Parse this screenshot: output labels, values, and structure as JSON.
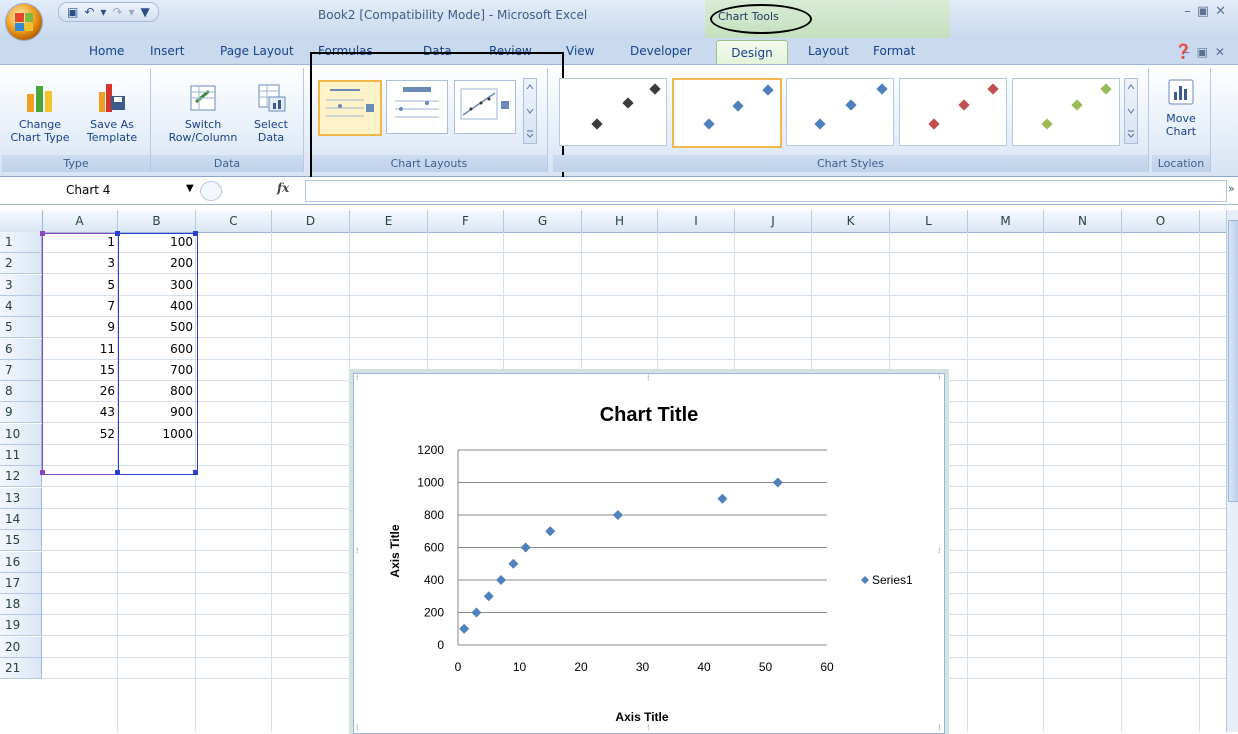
{
  "window": {
    "title": "Book2  [Compatibility Mode] - Microsoft Excel",
    "contextual_tab_group": "Chart Tools"
  },
  "tabs": [
    "Home",
    "Insert",
    "Page Layout",
    "Formulas",
    "Data",
    "Review",
    "View",
    "Developer",
    "Design",
    "Layout",
    "Format"
  ],
  "ribbon": {
    "type_group": {
      "label": "Type",
      "change_chart_type": "Change Chart Type",
      "save_as_template": "Save As Template"
    },
    "data_group": {
      "label": "Data",
      "switch_row_column": "Switch Row/Column",
      "select_data": "Select Data"
    },
    "chart_layouts_label": "Chart Layouts",
    "chart_styles_label": "Chart Styles",
    "location_group": {
      "label": "Location",
      "move_chart": "Move Chart"
    }
  },
  "formula_bar": {
    "name_box": "Chart 4",
    "fx_label": "fx",
    "formula": ""
  },
  "sheet": {
    "columns": [
      "A",
      "B",
      "C",
      "D",
      "E",
      "F",
      "G",
      "H",
      "I",
      "J",
      "K",
      "L",
      "M",
      "N",
      "O"
    ],
    "rows": [
      "1",
      "2",
      "3",
      "4",
      "5",
      "6",
      "7",
      "8",
      "9",
      "10",
      "11",
      "12",
      "13",
      "14",
      "15",
      "16",
      "17",
      "18",
      "19",
      "20",
      "21"
    ],
    "col_a": [
      "1",
      "3",
      "5",
      "7",
      "9",
      "11",
      "15",
      "26",
      "43",
      "52"
    ],
    "col_b": [
      "100",
      "200",
      "300",
      "400",
      "500",
      "600",
      "700",
      "800",
      "900",
      "1000"
    ]
  },
  "chart_data": {
    "type": "scatter",
    "title": "Chart Title",
    "xlabel": "Axis Title",
    "ylabel": "Axis Title",
    "xlim": [
      0,
      60
    ],
    "ylim": [
      0,
      1200
    ],
    "x_ticks": [
      "0",
      "10",
      "20",
      "30",
      "40",
      "50",
      "60"
    ],
    "y_ticks": [
      "0",
      "200",
      "400",
      "600",
      "800",
      "1000",
      "1200"
    ],
    "grid": "horizontal major gridlines",
    "legend_position": "right",
    "series": [
      {
        "name": "Series1",
        "x": [
          1,
          3,
          5,
          7,
          9,
          11,
          15,
          26,
          43,
          52
        ],
        "y": [
          100,
          200,
          300,
          400,
          500,
          600,
          700,
          800,
          900,
          1000
        ],
        "color": "#4f81bd",
        "marker": "diamond"
      }
    ]
  },
  "colors": {
    "ribbon_text": "#15428b",
    "selected_style_border": "#f2b64a",
    "series_marker": "#4f81bd"
  }
}
